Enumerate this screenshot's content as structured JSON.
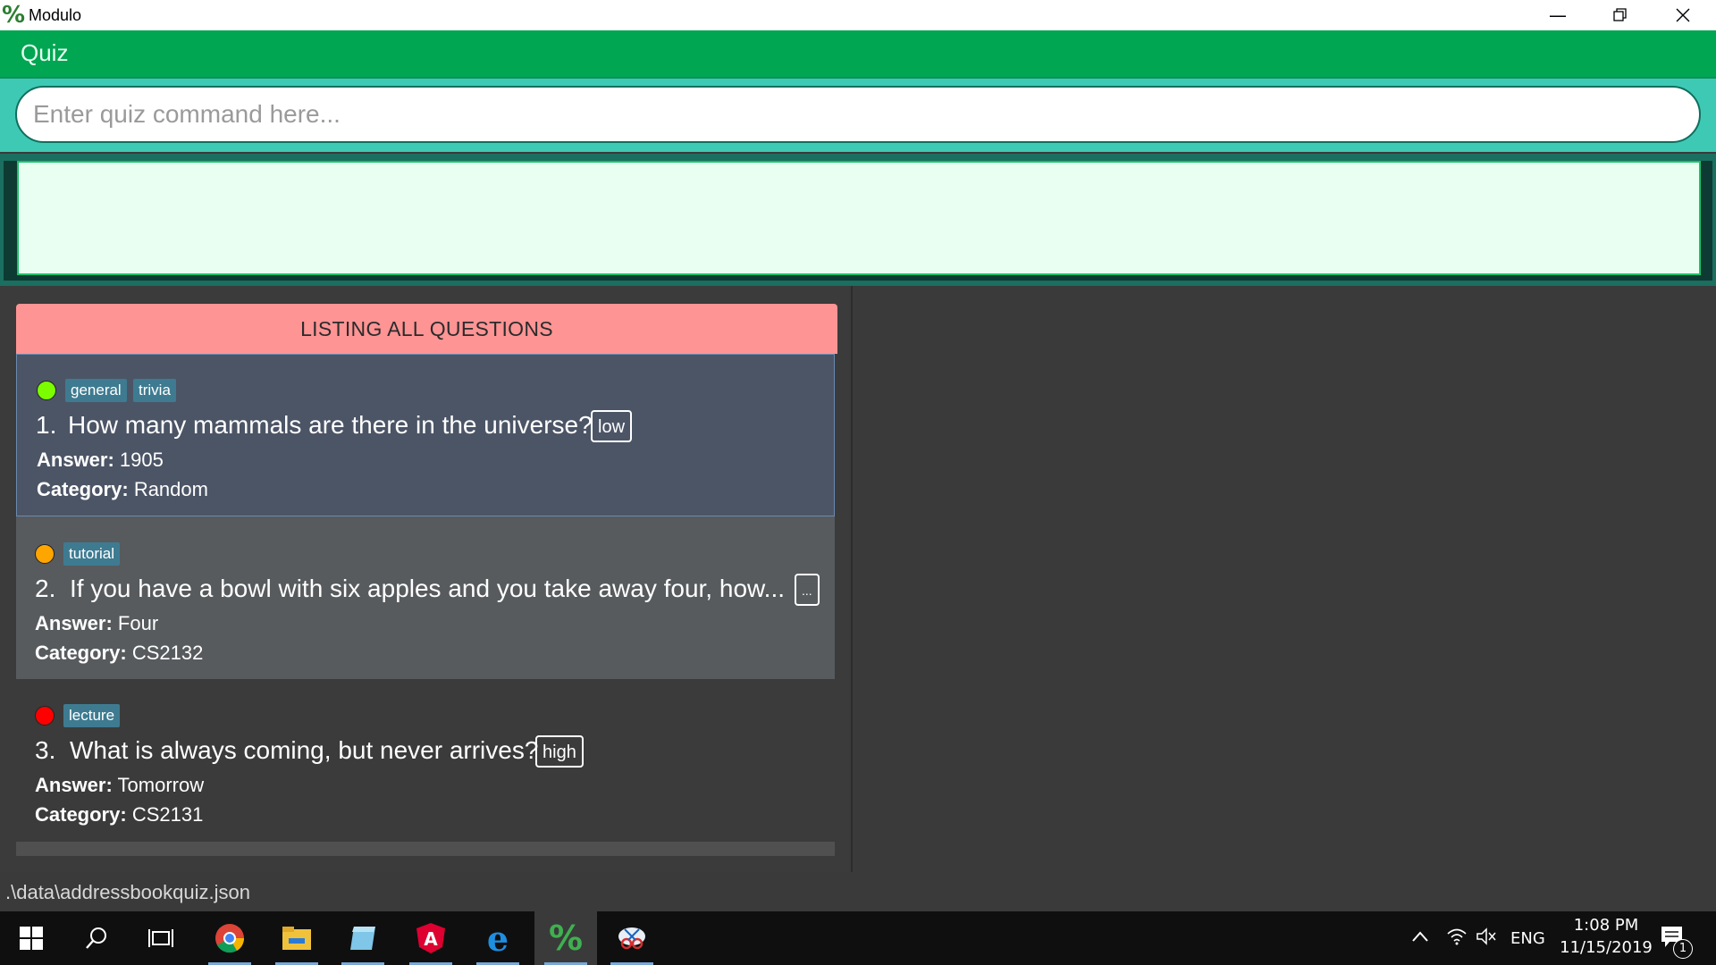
{
  "window": {
    "app_icon": "%",
    "title": "Modulo",
    "minimize_icon": "minimize-icon",
    "restore_icon": "restore-icon",
    "close_icon": "close-icon"
  },
  "menu": {
    "quiz_label": "Quiz"
  },
  "command": {
    "placeholder": "Enter quiz command here...",
    "value": ""
  },
  "result": {
    "text": ""
  },
  "list": {
    "header": "LISTING ALL QUESTIONS",
    "questions": [
      {
        "dot_color": "#7cfc00",
        "tags": [
          "general",
          "trivia"
        ],
        "number": "1.",
        "question": "How many mammals are there in the universe?",
        "difficulty": "low",
        "answer_label": "Answer:",
        "answer": "1905",
        "category_label": "Category:",
        "category": "Random"
      },
      {
        "dot_color": "#ffa500",
        "tags": [
          "tutorial"
        ],
        "number": "2.",
        "question": "If you have a bowl with six apples and you take away four, how...",
        "difficulty": "...",
        "answer_label": "Answer:",
        "answer": "Four",
        "category_label": "Category:",
        "category": "CS2132"
      },
      {
        "dot_color": "#ff0000",
        "tags": [
          "lecture"
        ],
        "number": "3.",
        "question": "What is always coming, but never arrives?",
        "difficulty": "high",
        "answer_label": "Answer:",
        "answer": "Tomorrow",
        "category_label": "Category:",
        "category": "CS2131"
      }
    ]
  },
  "status": {
    "path": ".\\data\\addressbookquiz.json"
  },
  "taskbar": {
    "apps": [
      "windows-start-icon",
      "search-icon",
      "task-view-icon",
      "chrome-icon",
      "file-explorer-icon",
      "notepad-icon",
      "angular-icon",
      "edge-icon",
      "modulo-icon",
      "snipping-tool-icon"
    ],
    "tray": {
      "language": "ENG",
      "time": "1:08 PM",
      "date": "11/15/2019",
      "notification_count": "1"
    }
  },
  "colors": {
    "menu_green": "#00a651",
    "command_teal": "#3ec9b5",
    "result_bg": "#e8fff1",
    "header_salmon": "#ff9494",
    "tag_blue": "#3e7b91"
  }
}
